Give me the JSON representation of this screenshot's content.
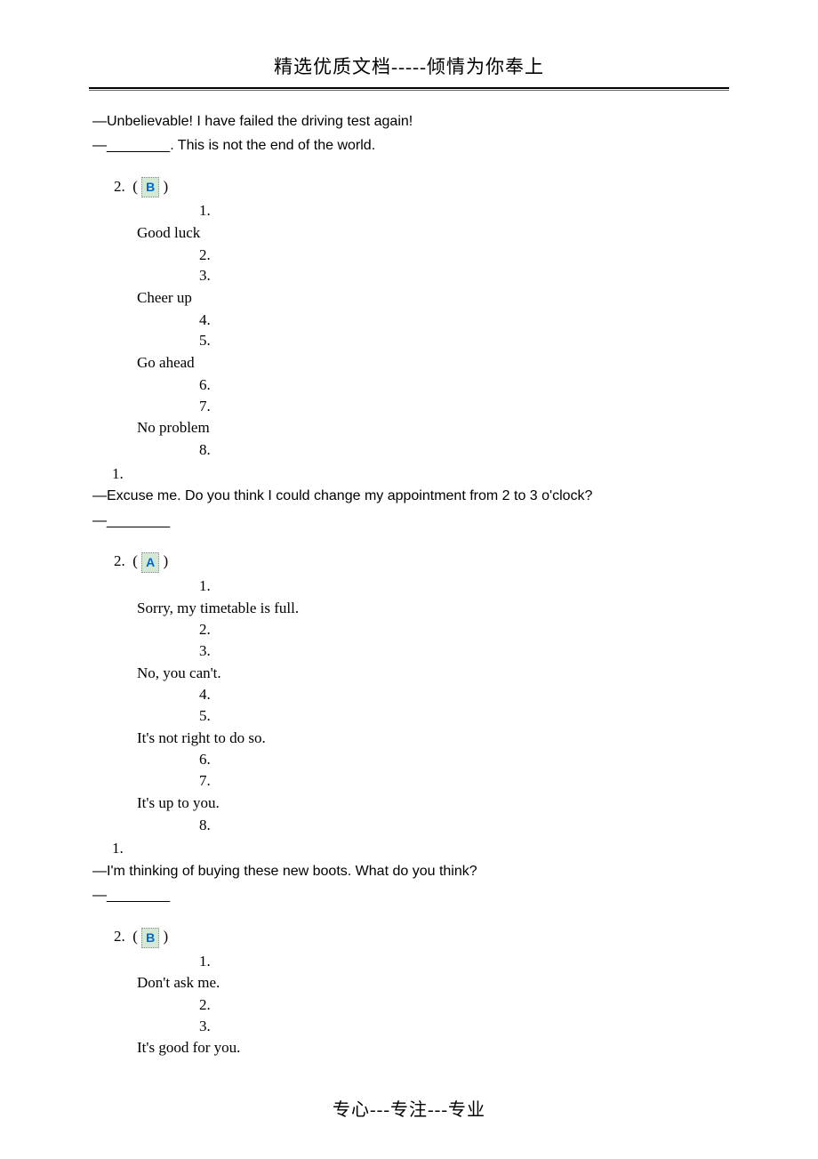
{
  "header": {
    "title": "精选优质文档-----倾情为你奉上"
  },
  "footer": {
    "text": "专心---专注---专业"
  },
  "questions": [
    {
      "prompt_line1": "—Unbelievable! I have failed the driving test again!",
      "prompt_line2": "—________. This is not the end of the world.",
      "num_label": "2.",
      "answer": "B",
      "sub_items": [
        {
          "num": "1.",
          "text": "Good luck"
        },
        {
          "num": "2.",
          "text": ""
        },
        {
          "num": "3.",
          "text": "Cheer up"
        },
        {
          "num": "4.",
          "text": ""
        },
        {
          "num": "5.",
          "text": "Go ahead"
        },
        {
          "num": "6.",
          "text": ""
        },
        {
          "num": "7.",
          "text": "No problem"
        },
        {
          "num": "8.",
          "text": ""
        }
      ],
      "trailing_one": "1."
    },
    {
      "prompt_line1": "—Excuse me. Do you think I could change my appointment from 2 to 3 o'clock?",
      "prompt_line2": "—________",
      "num_label": "2.",
      "answer": "A",
      "sub_items": [
        {
          "num": "1.",
          "text": "Sorry, my timetable is full."
        },
        {
          "num": "2.",
          "text": ""
        },
        {
          "num": "3.",
          "text": "No, you can't."
        },
        {
          "num": "4.",
          "text": ""
        },
        {
          "num": "5.",
          "text": "It's not right to do so."
        },
        {
          "num": "6.",
          "text": ""
        },
        {
          "num": "7.",
          "text": "It's up to you."
        },
        {
          "num": "8.",
          "text": ""
        }
      ],
      "trailing_one": "1."
    },
    {
      "prompt_line1": "—I'm thinking of buying these new boots. What do you think?",
      "prompt_line2": "—________",
      "num_label": "2.",
      "answer": "B",
      "sub_items": [
        {
          "num": "1.",
          "text": "Don't ask me."
        },
        {
          "num": "2.",
          "text": ""
        },
        {
          "num": "3.",
          "text": "It's good for you."
        }
      ],
      "trailing_one": null
    }
  ]
}
